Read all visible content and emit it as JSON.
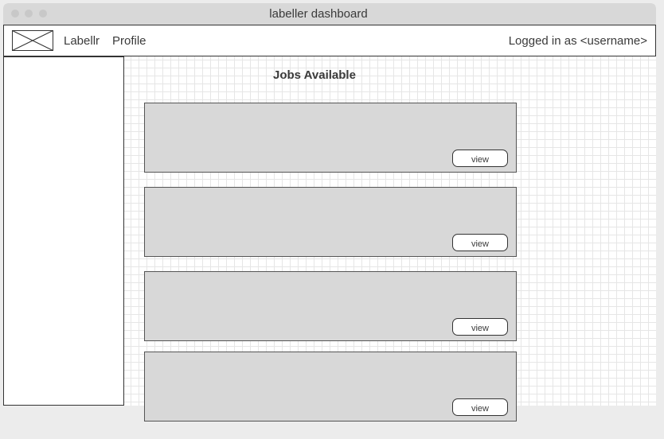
{
  "window": {
    "title": "labeller dashboard"
  },
  "navbar": {
    "logo_icon": "image-placeholder-icon",
    "brand": "Labellr",
    "profile": "Profile",
    "user_status": "Logged in as <username>"
  },
  "main": {
    "heading": "Jobs Available",
    "jobs": [
      {
        "button_label": "view"
      },
      {
        "button_label": "view"
      },
      {
        "button_label": "view"
      },
      {
        "button_label": "view"
      }
    ]
  },
  "colors": {
    "titlebar": "#d8d8d8",
    "card_fill": "#d8d8d8",
    "border": "#333333",
    "text": "#3a3a3a"
  }
}
